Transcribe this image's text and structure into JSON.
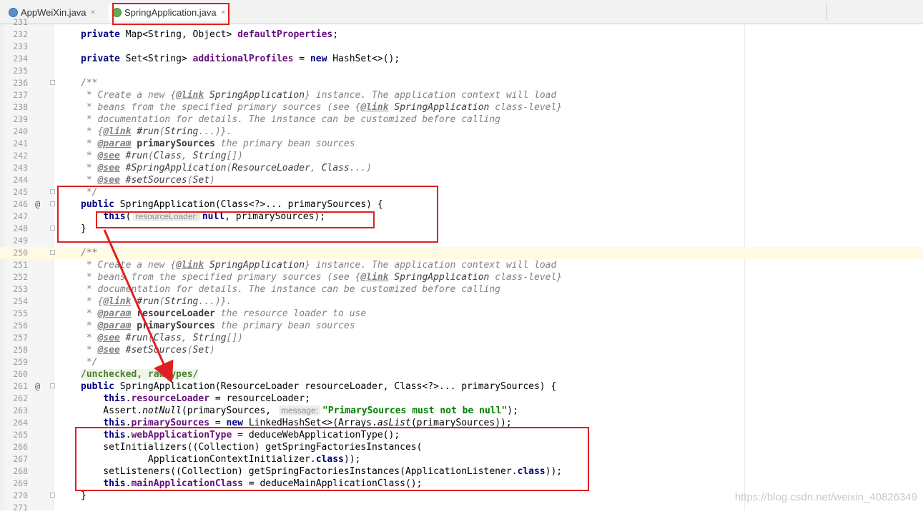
{
  "tabs": [
    {
      "label": "AppWeiXin.java",
      "close": "×",
      "icon": "java-class-icon",
      "active": false
    },
    {
      "label": "SpringApplication.java",
      "close": "×",
      "icon": "spring-class-icon",
      "active": true
    }
  ],
  "lines": [
    {
      "n": "231",
      "html": ""
    },
    {
      "n": "232",
      "html": "<span class=\"kw\">private</span> Map&lt;String, Object&gt; <span class=\"fld\">defaultProperties</span>;"
    },
    {
      "n": "233",
      "html": ""
    },
    {
      "n": "234",
      "html": "<span class=\"kw\">private</span> Set&lt;String&gt; <span class=\"fld\">additionalProfiles</span> = <span class=\"kw\">new</span> HashSet&lt;&gt;();"
    },
    {
      "n": "235",
      "html": ""
    },
    {
      "n": "236",
      "fold": true,
      "html": "<span class=\"cm\">/**</span>"
    },
    {
      "n": "237",
      "html": "<span class=\"cm\"> * Create a new {<span class=\"tag\">@link</span> <span class=\"cb\">SpringApplication</span>} instance. The application context will load</span>"
    },
    {
      "n": "238",
      "html": "<span class=\"cm\"> * beans from the specified primary sources (see {<span class=\"tag\">@link</span> <span class=\"cb\">SpringApplication</span> class-level}</span>"
    },
    {
      "n": "239",
      "html": "<span class=\"cm\"> * documentation for details. The instance can be customized before calling</span>"
    },
    {
      "n": "240",
      "html": "<span class=\"cm\"> * {<span class=\"tag\">@link</span> <span class=\"cb\">#run</span>(<span class=\"cb\">String</span>...)}.</span>"
    },
    {
      "n": "241",
      "html": "<span class=\"cm\"> * <span class=\"tag\">@param</span> <span class=\"pb\">primarySources</span> the primary bean sources</span>"
    },
    {
      "n": "242",
      "html": "<span class=\"cm\"> * <span class=\"tag\">@see</span> <span class=\"cb\">#run</span>(<span class=\"cb\">Class</span>, <span class=\"cb\">String</span>[])</span>"
    },
    {
      "n": "243",
      "html": "<span class=\"cm\"> * <span class=\"tag\">@see</span> <span class=\"cb\">#SpringApplication</span>(<span class=\"cb\">ResourceLoader</span>, <span class=\"cb\">Class</span>...)</span>"
    },
    {
      "n": "244",
      "html": "<span class=\"cm\"> * <span class=\"tag\">@see</span> <span class=\"cb\">#setSources</span>(<span class=\"cb\">Set</span>)</span>"
    },
    {
      "n": "245",
      "fold": true,
      "html": "<span class=\"cm\"> */</span>"
    },
    {
      "n": "246",
      "fold": true,
      "ann": "@",
      "html": "<span class=\"kw\">public</span> SpringApplication(Class&lt;?&gt;... primarySources) {"
    },
    {
      "n": "247",
      "html": "    <span class=\"kw\">this</span>(<span class=\"hint\">resourceLoader:</span><span class=\"kw\">null</span>, primarySources);"
    },
    {
      "n": "248",
      "fold": true,
      "html": "}"
    },
    {
      "n": "249",
      "html": ""
    },
    {
      "n": "250",
      "fold": true,
      "highlight": true,
      "html": "<span class=\"cm\">/**</span>"
    },
    {
      "n": "251",
      "html": "<span class=\"cm\"> * Create a new {<span class=\"tag\">@link</span> <span class=\"cb\">SpringApplication</span>} instance. The application context will load</span>"
    },
    {
      "n": "252",
      "html": "<span class=\"cm\"> * beans from the specified primary sources (see {<span class=\"tag\">@link</span> <span class=\"cb\">SpringApplication</span> class-level}</span>"
    },
    {
      "n": "253",
      "html": "<span class=\"cm\"> * documentation for details. The instance can be customized before calling</span>"
    },
    {
      "n": "254",
      "html": "<span class=\"cm\"> * {<span class=\"tag\">@link</span> <span class=\"cb\">#run</span>(<span class=\"cb\">String</span>...)}.</span>"
    },
    {
      "n": "255",
      "html": "<span class=\"cm\"> * <span class=\"tag\">@param</span> <span class=\"pb\">resourceLoader</span> the resource loader to use</span>"
    },
    {
      "n": "256",
      "html": "<span class=\"cm\"> * <span class=\"tag\">@param</span> <span class=\"pb\">primarySources</span> the primary bean sources</span>"
    },
    {
      "n": "257",
      "html": "<span class=\"cm\"> * <span class=\"tag\">@see</span> <span class=\"cb\">#run</span>(<span class=\"cb\">Class</span>, <span class=\"cb\">String</span>[])</span>"
    },
    {
      "n": "258",
      "html": "<span class=\"cm\"> * <span class=\"tag\">@see</span> <span class=\"cb\">#setSources</span>(<span class=\"cb\">Set</span>)</span>"
    },
    {
      "n": "259",
      "html": "<span class=\"cm\"> */</span>"
    },
    {
      "n": "260",
      "html": "<span class=\"sup\">/unchecked, rawtypes/</span>"
    },
    {
      "n": "261",
      "fold": true,
      "ann": "@",
      "html": "<span class=\"kw\">public</span> SpringApplication(ResourceLoader resourceLoader, Class&lt;?&gt;... primarySources) {"
    },
    {
      "n": "262",
      "html": "    <span class=\"kw\">this</span>.<span class=\"fld\">resourceLoader</span> = resourceLoader;"
    },
    {
      "n": "263",
      "html": "    Assert.<span class=\"it\">notNull</span>(primarySources, <span class=\"hint\">message:</span><span class=\"str\">\"PrimarySources must not be null\"</span>);"
    },
    {
      "n": "264",
      "html": "    <span class=\"kw\">this</span>.<span class=\"fld\">primarySources</span> = <span class=\"kw\">new</span> LinkedHashSet&lt;&gt;(Arrays.<span class=\"it\">asList</span>(primarySources));"
    },
    {
      "n": "265",
      "html": "    <span class=\"kw\">this</span>.<span class=\"fld\">webApplicationType</span> = deduceWebApplicationType();"
    },
    {
      "n": "266",
      "html": "    setInitializers((Collection) getSpringFactoriesInstances("
    },
    {
      "n": "267",
      "html": "            ApplicationContextInitializer.<span class=\"kw\">class</span>));"
    },
    {
      "n": "268",
      "html": "    setListeners((Collection) getSpringFactoriesInstances(ApplicationListener.<span class=\"kw\">class</span>));"
    },
    {
      "n": "269",
      "html": "    <span class=\"kw\">this</span>.<span class=\"fld\">mainApplicationClass</span> = deduceMainApplicationClass();"
    },
    {
      "n": "270",
      "fold": true,
      "html": "}"
    },
    {
      "n": "271",
      "html": ""
    }
  ],
  "watermark": "https://blog.csdn.net/weixin_40826349",
  "colors": {
    "annotation_red": "#e02020",
    "keyword": "#000080",
    "field": "#660e7a",
    "string": "#008000",
    "comment": "#808080"
  }
}
